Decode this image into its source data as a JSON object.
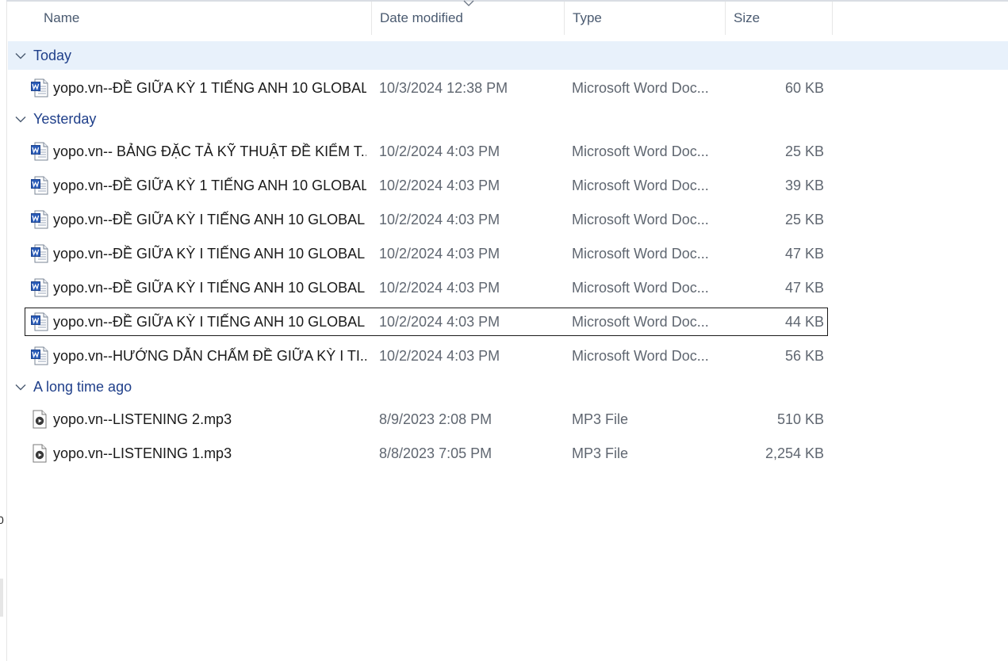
{
  "columns": {
    "name": "Name",
    "date": "Date modified",
    "type": "Type",
    "size": "Size"
  },
  "left_edge_glyph": "0",
  "groups": [
    {
      "label": "Today",
      "files": [
        {
          "name": "yopo.vn--ĐỀ GIỮA KỲ 1 TIẾNG ANH 10 GLOBAL...",
          "date": "10/3/2024 12:38 PM",
          "type": "Microsoft Word Doc...",
          "size": "60 KB",
          "icon": "word-doc-icon"
        }
      ]
    },
    {
      "label": "Yesterday",
      "files": [
        {
          "name": "yopo.vn-- BẢNG ĐẶC TẢ KỸ THUẬT ĐỀ KIỂM T...",
          "date": "10/2/2024 4:03 PM",
          "type": "Microsoft Word Doc...",
          "size": "25 KB",
          "icon": "word-doc-icon"
        },
        {
          "name": "yopo.vn--ĐỀ GIỮA KỲ 1 TIẾNG ANH 10 GLOBAL...",
          "date": "10/2/2024 4:03 PM",
          "type": "Microsoft Word Doc...",
          "size": "39 KB",
          "icon": "word-doc-icon"
        },
        {
          "name": "yopo.vn--ĐỀ GIỮA KỲ I TIẾNG ANH 10 GLOBAL ...",
          "date": "10/2/2024 4:03 PM",
          "type": "Microsoft Word Doc...",
          "size": "25 KB",
          "icon": "word-doc-icon"
        },
        {
          "name": "yopo.vn--ĐỀ GIỮA KỲ I TIẾNG ANH 10 GLOBAL ...",
          "date": "10/2/2024 4:03 PM",
          "type": "Microsoft Word Doc...",
          "size": "47 KB",
          "icon": "word-doc-icon"
        },
        {
          "name": "yopo.vn--ĐỀ GIỮA KỲ I TIẾNG ANH 10 GLOBAL ...",
          "date": "10/2/2024 4:03 PM",
          "type": "Microsoft Word Doc...",
          "size": "47 KB",
          "icon": "word-doc-icon"
        },
        {
          "name": "yopo.vn--ĐỀ GIỮA KỲ I TIẾNG ANH 10 GLOBAL ...",
          "date": "10/2/2024 4:03 PM",
          "type": "Microsoft Word Doc...",
          "size": "44 KB",
          "icon": "word-doc-icon",
          "selected": true
        },
        {
          "name": "yopo.vn--HƯỚNG DẪN CHẤM ĐỀ GIỮA KỲ I TI...",
          "date": "10/2/2024 4:03 PM",
          "type": "Microsoft Word Doc...",
          "size": "56 KB",
          "icon": "word-doc-icon"
        }
      ]
    },
    {
      "label": "A long time ago",
      "files": [
        {
          "name": "yopo.vn--LISTENING 2.mp3",
          "date": "8/9/2023 2:08 PM",
          "type": "MP3 File",
          "size": "510 KB",
          "icon": "mp3-file-icon"
        },
        {
          "name": "yopo.vn--LISTENING 1.mp3",
          "date": "8/8/2023 7:05 PM",
          "type": "MP3 File",
          "size": "2,254 KB",
          "icon": "mp3-file-icon"
        }
      ]
    }
  ],
  "colors": {
    "group_label": "#1f3f8a",
    "group_highlight": "#e8f1fb",
    "header_text": "#4a5a70",
    "secondary_text": "#5f6670"
  }
}
